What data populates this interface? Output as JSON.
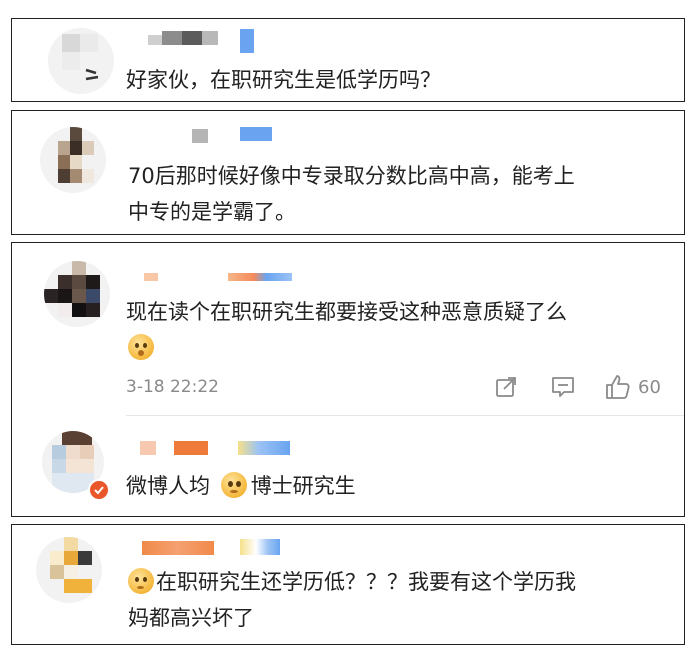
{
  "comments": [
    {
      "text": "好家伙，在职研究生是低学历吗？"
    },
    {
      "text_line1": "70后那时候好像中专录取分数比高中高，能考上",
      "text_line2": "中专的是学霸了。"
    },
    {
      "text": "现在读个在职研究生都要接受这种恶意质疑了么",
      "emoji": "flushed-face-emoji",
      "timestamp": "3-18 22:22",
      "likes": "60",
      "reply": {
        "text_before": "微博人均",
        "emoji": "pleading-face-emoji",
        "text_after": "博士研究生"
      }
    },
    {
      "emoji": "thinking-face-emoji",
      "text_line1": "在职研究生还学历低？？？我要有这个学历我",
      "text_line2": "妈都高兴坏了"
    }
  ],
  "colors": {
    "border": "#222222",
    "meta": "#8a8a8a",
    "name_blur_orange": "#f07a3a",
    "name_blur_blue": "#6aa4f0",
    "name_blur_gray": "#9a9a9a"
  },
  "icons": {
    "share": "share-icon",
    "comment": "comment-icon",
    "like": "thumbs-up-icon"
  }
}
